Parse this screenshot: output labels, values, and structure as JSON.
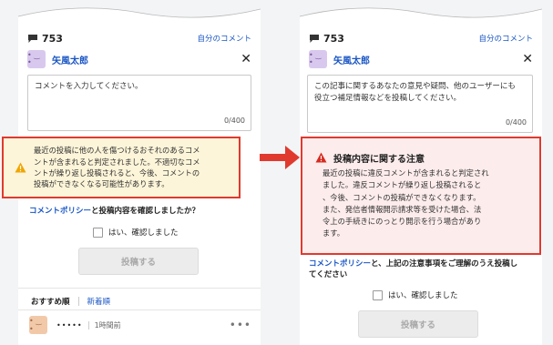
{
  "left": {
    "comment_count": "753",
    "my_comments_link": "自分のコメント",
    "user_name": "矢風太郎",
    "input_placeholder": "コメントを入力してください。",
    "char_counter": "0/400",
    "warning_lines": [
      "最近の投稿に他の人を傷つけるおそれのあるコメ",
      "ントが含まれると判定されました。不適切なコメ",
      "ントが繰り返し投稿されると、今後、コメントの",
      "投稿ができなくなる可能性があります。"
    ],
    "policy_link": "コメントポリシー",
    "policy_rest": "と投稿内容を確認しましたか？",
    "confirm_label": "はい、確認しました",
    "submit_label": "投稿する",
    "tab_recommended": "おすすめ順",
    "tab_newest": "新着順",
    "comment_user": "•••••",
    "comment_time": "1時間前",
    "more": "•••"
  },
  "right": {
    "comment_count": "753",
    "my_comments_link": "自分のコメント",
    "user_name": "矢風太郎",
    "input_placeholder_lines": [
      "この記事に関するあなたの意見や疑問、他のユーザーにも",
      "役立つ補足情報などを投稿してください。"
    ],
    "char_counter": "0/400",
    "notice_title": "投稿内容に関する注意",
    "notice_lines": [
      "最近の投稿に違反コメントが含まれると判定され",
      "ました。違反コメントが繰り返し投稿されると",
      "、今後、コメントの投稿ができなくなります。",
      "また、発信者情報開示請求等を受けた場合、法",
      "令上の手続きにのっとり開示を行う場合があり",
      "ます。"
    ],
    "policy_link": "コメントポリシー",
    "policy_rest_line1": "と、上記の注意事項をご理解のうえ投稿し",
    "policy_rest_line2": "てください",
    "confirm_label": "はい、確認しました",
    "submit_label": "投稿する"
  },
  "colors": {
    "link": "#1a56c4",
    "warning_border": "#e03a2f",
    "warning_bg_left": "#fdf5d9",
    "warning_bg_right": "#fdecec",
    "caution_icon": "#f0a500",
    "alert_icon": "#d62b20"
  },
  "icons": {
    "comment": "speech-bubble-icon",
    "close": "close-icon",
    "caution": "warning-triangle-icon",
    "alert": "alert-triangle-icon",
    "transition": "right-arrow-icon"
  }
}
